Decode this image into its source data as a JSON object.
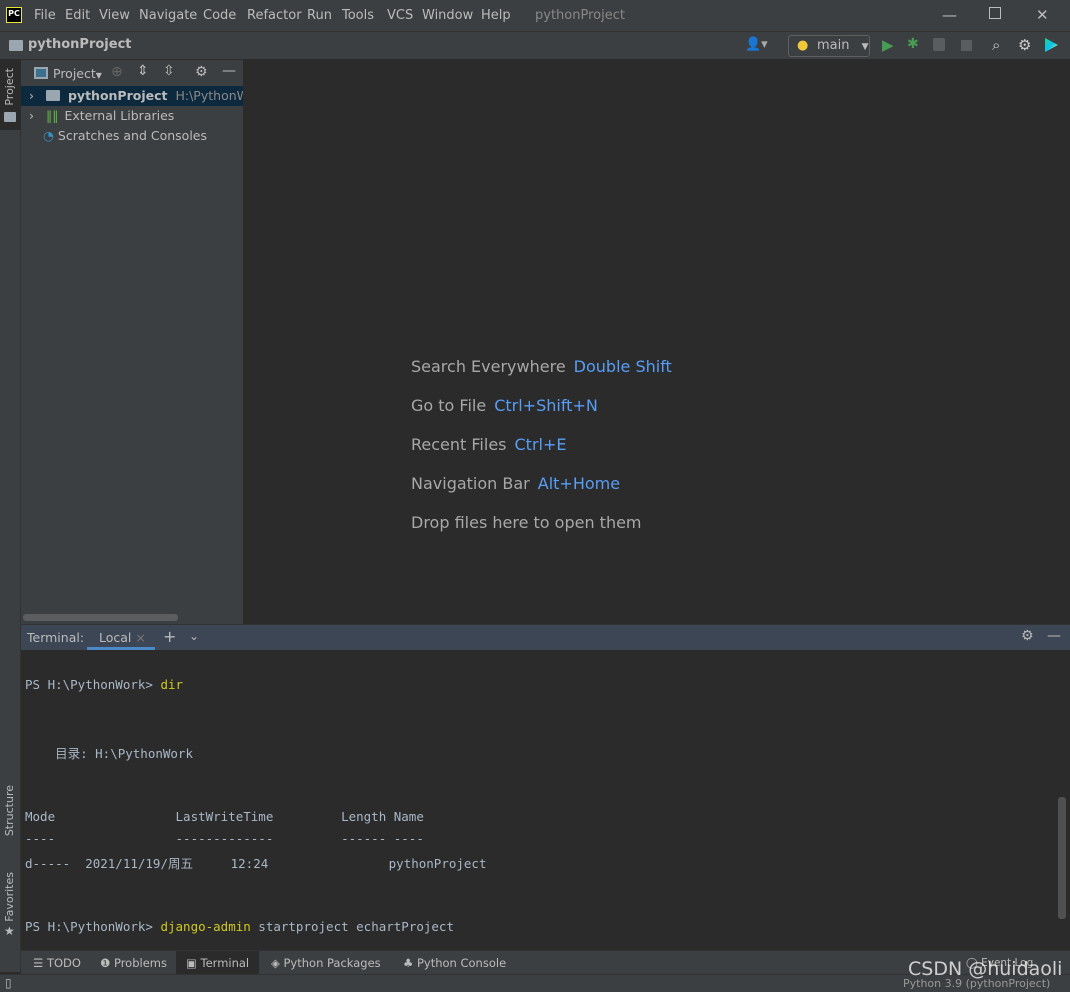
{
  "app": {
    "logo": "PC",
    "window_title": "pythonProject"
  },
  "menu": [
    "File",
    "Edit",
    "View",
    "Navigate",
    "Code",
    "Refactor",
    "Run",
    "Tools",
    "VCS",
    "Window",
    "Help"
  ],
  "navbar": {
    "breadcrumb": "pythonProject",
    "run_config": "main"
  },
  "left_strip": {
    "project": "Project",
    "structure": "Structure",
    "favorites": "Favorites"
  },
  "project_pane": {
    "view_label": "Project",
    "tree": [
      {
        "label": "pythonProject",
        "path": "H:\\PythonWork"
      },
      {
        "label": "External Libraries"
      },
      {
        "label": "Scratches and Consoles"
      }
    ]
  },
  "editor_hints": [
    {
      "label": "Search Everywhere",
      "shortcut": "Double Shift"
    },
    {
      "label": "Go to File",
      "shortcut": "Ctrl+Shift+N"
    },
    {
      "label": "Recent Files",
      "shortcut": "Ctrl+E"
    },
    {
      "label": "Navigation Bar",
      "shortcut": "Alt+Home"
    },
    {
      "label": "Drop files here to open them",
      "shortcut": ""
    }
  ],
  "terminal": {
    "title": "Terminal:",
    "tab": "Local",
    "prompt1": "PS H:\\PythonWork> ",
    "cmd1": "dir",
    "dir_line": "    目录: H:\\PythonWork",
    "header": "Mode                LastWriteTime         Length Name",
    "sep": "----                -------------         ------ ----",
    "row": "d-----  2021/11/19/周五     12:24                pythonProject",
    "prompt2": "PS H:\\PythonWork> ",
    "cmd2": "django-admin",
    "args2": " startproject echartProject"
  },
  "bottom_tabs": [
    "TODO",
    "Problems",
    "Terminal",
    "Python Packages",
    "Python Console"
  ],
  "event_log": "Event Log",
  "status": {
    "interpreter": "Python 3.9 (pythonProject)"
  },
  "watermark": "CSDN @huidaoli",
  "colors": {
    "accent": "#589df6",
    "selection": "#0d293e",
    "prompt_cmd": "#d0c91e"
  }
}
